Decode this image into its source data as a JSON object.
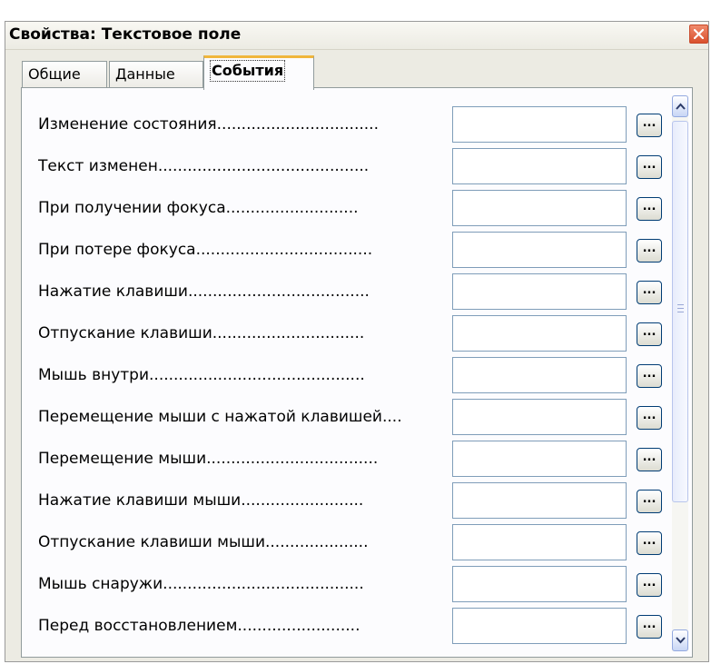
{
  "window": {
    "title": "Свойства: Текстовое поле"
  },
  "tabs": [
    {
      "label": "Общие",
      "active": false
    },
    {
      "label": "Данные",
      "active": false
    },
    {
      "label": "События",
      "active": true
    }
  ],
  "events": [
    {
      "label": "Изменение состояния.................................",
      "value": "",
      "button": "..."
    },
    {
      "label": "Текст изменен...........................................",
      "value": "",
      "button": "..."
    },
    {
      "label": "При получении фокуса...........................",
      "value": "",
      "button": "..."
    },
    {
      "label": "При потере фокуса....................................",
      "value": "",
      "button": "..."
    },
    {
      "label": "Нажатие клавиши.....................................",
      "value": "",
      "button": "..."
    },
    {
      "label": "Отпускание клавиши...............................",
      "value": "",
      "button": "..."
    },
    {
      "label": "Мышь внутри............................................",
      "value": "",
      "button": "..."
    },
    {
      "label": "Перемещение мыши с нажатой клавишей....",
      "value": "",
      "button": "..."
    },
    {
      "label": "Перемещение мыши...................................",
      "value": "",
      "button": "..."
    },
    {
      "label": "Нажатие клавиши мыши.........................",
      "value": "",
      "button": "..."
    },
    {
      "label": "Отпускание клавиши мыши.....................",
      "value": "",
      "button": "..."
    },
    {
      "label": "Мышь снаружи.........................................",
      "value": "",
      "button": "..."
    },
    {
      "label": "Перед восстановлением.........................",
      "value": "",
      "button": "..."
    }
  ],
  "icons": {
    "close": "close-icon",
    "scroll_up": "chevron-up-icon",
    "scroll_down": "chevron-down-icon"
  },
  "colors": {
    "tab_accent": "#f0b63c",
    "close_button": "#d9502d",
    "input_border": "#7f9db9"
  }
}
